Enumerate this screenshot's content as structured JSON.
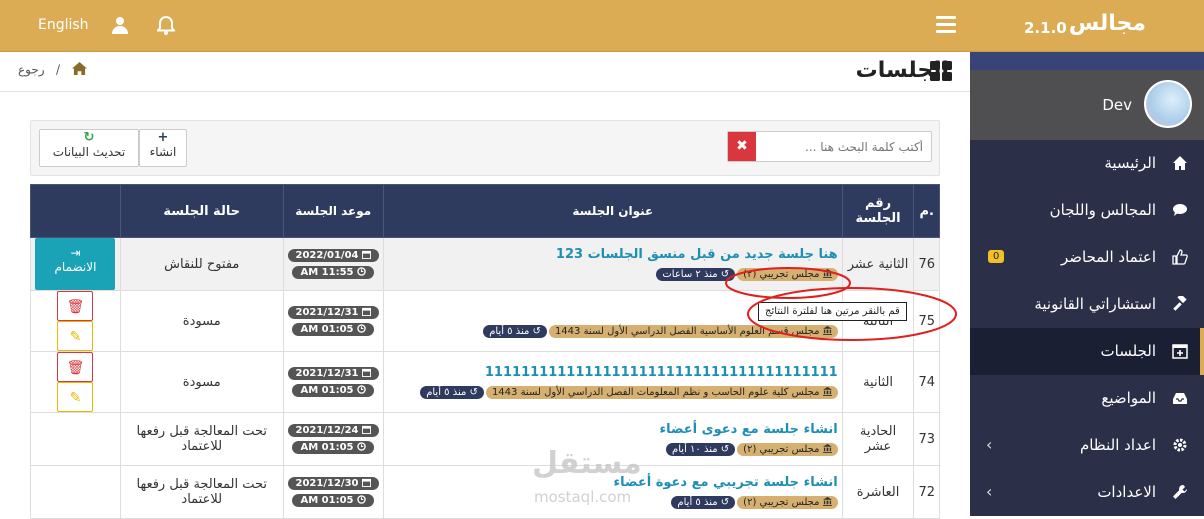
{
  "header": {
    "language": "English"
  },
  "brand": {
    "name": "مجالس",
    "version": "2.1.0"
  },
  "profile": {
    "username": "Dev"
  },
  "menu": {
    "items": [
      {
        "label": "الرئيسية",
        "icon": "home-icon"
      },
      {
        "label": "المجالس واللجان",
        "icon": "comments-icon"
      },
      {
        "label": "اعتماد المحاضر",
        "icon": "thumbs-up-icon",
        "badge": "0"
      },
      {
        "label": "استشاراتي القانونية",
        "icon": "gavel-icon"
      },
      {
        "label": "الجلسات",
        "icon": "calendar-plus-icon",
        "active": true
      },
      {
        "label": "المواضيع",
        "icon": "inbox-icon"
      },
      {
        "label": "اعداد النظام",
        "icon": "cog-icon",
        "chevron": "‹"
      },
      {
        "label": "الاعدادات",
        "icon": "wrench-icon",
        "chevron": "‹"
      }
    ]
  },
  "breadcrumb": {
    "separator": "/",
    "back": "رجوع"
  },
  "page": {
    "title": "الجلسات"
  },
  "toolbar": {
    "new_label": "انشاء",
    "new_glyph": "+",
    "refresh_label": "تحديث البيانات",
    "refresh_glyph": "↻",
    "search_placeholder": "أكتب كلمة البحث هنا ...",
    "clear_glyph": "✖"
  },
  "table": {
    "headers": {
      "no": "م.",
      "num": "رقم الجلسة",
      "title": "عنوان الجلسة",
      "date": "موعد الجلسة",
      "state": "حالة الجلسة",
      "actions": ""
    },
    "rows": [
      {
        "no": "76",
        "num": "الثانية عشر",
        "title": "هنا جلسة جديد من قبل منسق الجلسات 123",
        "council": "مجلس تجريبي (٢)",
        "ago": "منذ ٢ ساعات",
        "date": "2022/01/04",
        "time": "AM 11:55",
        "state": "مفتوح للنقاش",
        "action": "join",
        "join_label": "الانضمام"
      },
      {
        "no": "75",
        "num": "الثالثة",
        "title": "1234",
        "council": "مجلس قسم العلوم الأساسية الفصل الدراسي الأول لسنة 1443",
        "ago": "منذ ٥ أيام",
        "date": "2021/12/31",
        "time": "AM 01:05",
        "state": "مسودة",
        "action": "edit"
      },
      {
        "no": "74",
        "num": "الثانية",
        "title": "111111111111111111111111111111111111111",
        "council": "مجلس كلية علوم الحاسب و نظم المعلومات الفصل الدراسي الأول لسنة 1443",
        "ago": "منذ ٥ أيام",
        "date": "2021/12/31",
        "time": "AM 01:05",
        "state": "مسودة",
        "action": "edit"
      },
      {
        "no": "73",
        "num": "الحادية عشر",
        "title": "انشاء جلسة مع دعوى أعضاء",
        "council": "مجلس تجريبي (٢)",
        "ago": "منذ ١٠ أيام",
        "date": "2021/12/24",
        "time": "AM 01:05",
        "state": "تحت المعالجة قبل رفعها للاعتماد",
        "action": "none"
      },
      {
        "no": "72",
        "num": "العاشرة",
        "title": "انشاء جلسة تجريبي مع دعوة أعضاء",
        "council": "مجلس تجريبي (٢)",
        "ago": "منذ ٥ أيام",
        "date": "2021/12/30",
        "time": "AM 01:05",
        "state": "تحت المعالجة قبل رفعها للاعتماد",
        "action": "none"
      }
    ]
  },
  "tooltip": "قم بالنقر مرتين هنا لفلترة النتائج",
  "watermark": {
    "arabic": "مستقل",
    "latin": "mostaql.com"
  },
  "colors": {
    "gold": "#dcac55",
    "navy": "#2f3a5f",
    "sidebar": "#2b2f48",
    "teal": "#1aa3b6",
    "red": "#d9363e"
  }
}
